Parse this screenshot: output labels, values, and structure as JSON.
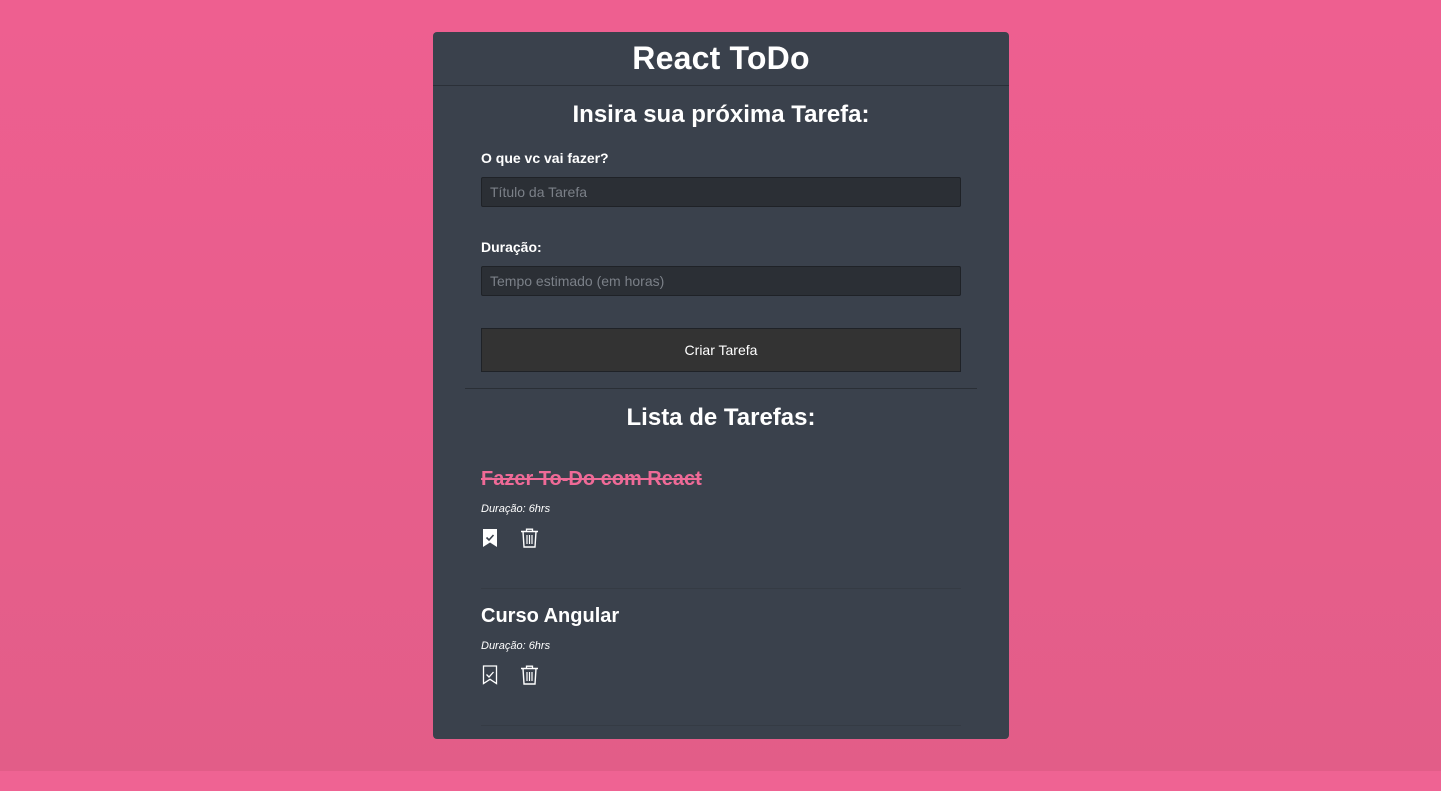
{
  "app": {
    "title": "React ToDo"
  },
  "form": {
    "heading": "Insira sua próxima Tarefa:",
    "title_label": "O que vc vai fazer?",
    "title_placeholder": "Título da Tarefa",
    "title_value": "",
    "duration_label": "Duração:",
    "duration_placeholder": "Tempo estimado (em horas)",
    "duration_value": "",
    "submit_label": "Criar Tarefa"
  },
  "list": {
    "heading": "Lista de Tarefas:",
    "tasks": [
      {
        "title": "Fazer To-Do com React",
        "duration": "Duração: 6hrs",
        "done": true,
        "complete_icon": "bookmark-check-filled-icon",
        "delete_icon": "trash-icon"
      },
      {
        "title": "Curso Angular",
        "duration": "Duração: 6hrs",
        "done": false,
        "complete_icon": "bookmark-check-outline-icon",
        "delete_icon": "trash-icon"
      }
    ]
  },
  "colors": {
    "background": "#ee5f90",
    "card": "#3a414c",
    "input": "#2b2f35",
    "button": "#333333",
    "done_text": "#ef6a97",
    "text": "#ffffff"
  }
}
